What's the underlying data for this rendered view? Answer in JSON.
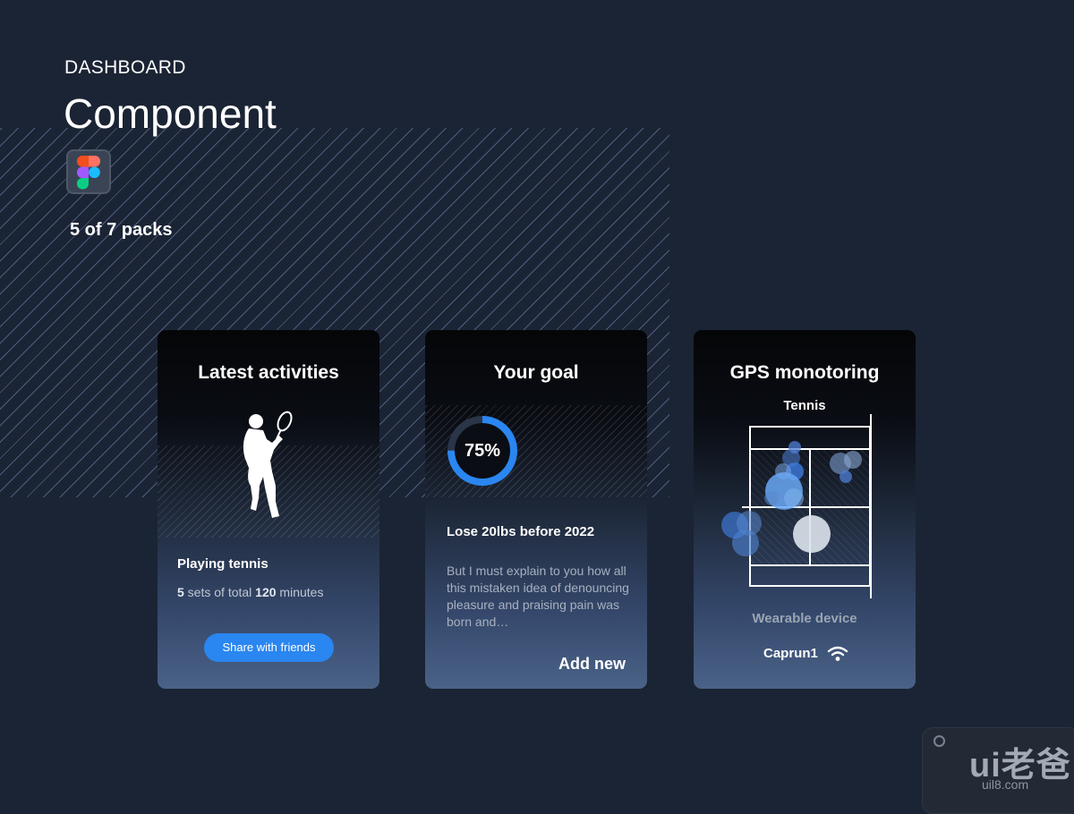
{
  "header": {
    "kicker": "DASHBOARD",
    "title": "Component",
    "packs": "5 of 7 packs"
  },
  "cards": [
    {
      "title": "Latest activities",
      "activity": "Playing tennis",
      "sets": "5",
      "sets_label": " sets of total ",
      "minutes": "120",
      "minutes_label": " minutes",
      "button": "Share with friends"
    },
    {
      "title": "Your goal",
      "progress": 0.75,
      "progress_label": "75%",
      "goal": "Lose 20lbs before 2022",
      "description": "But I must explain to you how all this mistaken idea of denouncing pleasure and praising pain was born and…",
      "action": "Add new"
    },
    {
      "title": "GPS monotoring",
      "court_label": "Tennis",
      "device_label": "Wearable device",
      "device_name": "Caprun1"
    }
  ],
  "watermark": {
    "logo": "ui老爸",
    "site": "uil8.com"
  },
  "colors": {
    "background": "#1b2434",
    "accent": "#2a86f0",
    "muted_text": "#a7b0bf"
  },
  "icons": [
    "figma-icon",
    "tennis-player-icon",
    "wifi-icon"
  ]
}
